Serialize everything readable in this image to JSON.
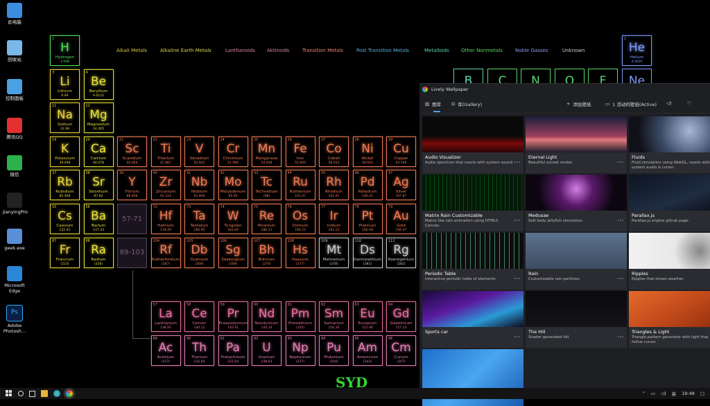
{
  "desktop_icons": [
    {
      "label": "此电脑",
      "icon": "computer-icon"
    },
    {
      "label": "回收站",
      "icon": "recycle-bin-icon"
    },
    {
      "label": "控制面板",
      "icon": "control-panel-icon"
    },
    {
      "label": "腾讯QQ",
      "icon": "qq-icon"
    },
    {
      "label": "微信",
      "icon": "wechat-icon"
    },
    {
      "label": "JianyingPro",
      "icon": "jianying-icon"
    },
    {
      "label": "geek.exe",
      "icon": "geek-icon"
    },
    {
      "label": "Microsoft Edge",
      "icon": "edge-icon"
    },
    {
      "label": "Adobe Photosh...",
      "icon": "photoshop-icon"
    }
  ],
  "legend": [
    {
      "label": "Alkali Metals",
      "color": "#d7c347"
    },
    {
      "label": "Alkaline Earth Metals",
      "color": "#d7d64a"
    },
    {
      "label": "Lanthanoids",
      "color": "#d98aa9"
    },
    {
      "label": "Aktinoids",
      "color": "#d48cae"
    },
    {
      "label": "Transition Metals",
      "color": "#e98a6d"
    },
    {
      "label": "Post Transition Metals",
      "color": "#5bb0de"
    },
    {
      "label": "Metalloids",
      "color": "#5ed4b4"
    },
    {
      "label": "Other Nonmetals",
      "color": "#5bd96b"
    },
    {
      "label": "Noble Gasses",
      "color": "#8ea0ef"
    },
    {
      "label": "Unknown",
      "color": "#cccccc"
    }
  ],
  "elements": [
    {
      "n": "1",
      "s": "H",
      "name": "Hydrogen",
      "m": "1.008",
      "c": "#4fe25b",
      "col": 0,
      "row": 0
    },
    {
      "n": "2",
      "s": "He",
      "name": "Helium",
      "m": "4.0026",
      "c": "#7e9cff",
      "col": 17,
      "row": 0
    },
    {
      "n": "3",
      "s": "Li",
      "name": "Lithium",
      "m": "6.94",
      "c": "#e9d43c",
      "col": 0,
      "row": 1
    },
    {
      "n": "4",
      "s": "Be",
      "name": "Beryllium",
      "m": "9.0122",
      "c": "#e6e23d",
      "col": 1,
      "row": 1
    },
    {
      "n": "11",
      "s": "Na",
      "name": "Sodium",
      "m": "22.99",
      "c": "#e9d43c",
      "col": 0,
      "row": 2
    },
    {
      "n": "12",
      "s": "Mg",
      "name": "Magnesium",
      "m": "24.305",
      "c": "#e6e23d",
      "col": 1,
      "row": 2
    },
    {
      "n": "19",
      "s": "K",
      "name": "Potassium",
      "m": "39.098",
      "c": "#e9d43c",
      "col": 0,
      "row": 3
    },
    {
      "n": "20",
      "s": "Ca",
      "name": "Calcium",
      "m": "40.078",
      "c": "#e6e23d",
      "col": 1,
      "row": 3
    },
    {
      "n": "21",
      "s": "Sc",
      "name": "Scandium",
      "m": "44.956",
      "c": "#f07a55",
      "col": 2,
      "row": 3
    },
    {
      "n": "22",
      "s": "Ti",
      "name": "Titanium",
      "m": "47.867",
      "c": "#f07a55",
      "col": 3,
      "row": 3
    },
    {
      "n": "23",
      "s": "V",
      "name": "Vanadium",
      "m": "50.942",
      "c": "#f07a55",
      "col": 4,
      "row": 3
    },
    {
      "n": "24",
      "s": "Cr",
      "name": "Chromium",
      "m": "51.996",
      "c": "#f07a55",
      "col": 5,
      "row": 3
    },
    {
      "n": "25",
      "s": "Mn",
      "name": "Manganese",
      "m": "54.938",
      "c": "#f07a55",
      "col": 6,
      "row": 3
    },
    {
      "n": "26",
      "s": "Fe",
      "name": "Iron",
      "m": "55.845",
      "c": "#f07a55",
      "col": 7,
      "row": 3
    },
    {
      "n": "27",
      "s": "Co",
      "name": "Cobalt",
      "m": "58.933",
      "c": "#f07a55",
      "col": 8,
      "row": 3
    },
    {
      "n": "28",
      "s": "Ni",
      "name": "Nickel",
      "m": "58.693",
      "c": "#f07a55",
      "col": 9,
      "row": 3
    },
    {
      "n": "29",
      "s": "Cu",
      "name": "Copper",
      "m": "63.546",
      "c": "#f07a55",
      "col": 10,
      "row": 3
    },
    {
      "n": "37",
      "s": "Rb",
      "name": "Rubidium",
      "m": "85.468",
      "c": "#e9d43c",
      "col": 0,
      "row": 4
    },
    {
      "n": "38",
      "s": "Sr",
      "name": "Strontium",
      "m": "87.62",
      "c": "#e6e23d",
      "col": 1,
      "row": 4
    },
    {
      "n": "39",
      "s": "Y",
      "name": "Yttrium",
      "m": "88.906",
      "c": "#f07a55",
      "col": 2,
      "row": 4
    },
    {
      "n": "40",
      "s": "Zr",
      "name": "Zirconium",
      "m": "91.224",
      "c": "#f07a55",
      "col": 3,
      "row": 4
    },
    {
      "n": "41",
      "s": "Nb",
      "name": "Niobium",
      "m": "92.906",
      "c": "#f07a55",
      "col": 4,
      "row": 4
    },
    {
      "n": "42",
      "s": "Mo",
      "name": "Molybdenum",
      "m": "95.95",
      "c": "#f07a55",
      "col": 5,
      "row": 4
    },
    {
      "n": "43",
      "s": "Tc",
      "name": "Technetium",
      "m": "(98)",
      "c": "#f07a55",
      "col": 6,
      "row": 4
    },
    {
      "n": "44",
      "s": "Ru",
      "name": "Ruthenium",
      "m": "101.07",
      "c": "#f07a55",
      "col": 7,
      "row": 4
    },
    {
      "n": "45",
      "s": "Rh",
      "name": "Rhodium",
      "m": "102.91",
      "c": "#f07a55",
      "col": 8,
      "row": 4
    },
    {
      "n": "46",
      "s": "Pd",
      "name": "Palladium",
      "m": "106.42",
      "c": "#f07a55",
      "col": 9,
      "row": 4
    },
    {
      "n": "47",
      "s": "Ag",
      "name": "Silver",
      "m": "107.87",
      "c": "#f07a55",
      "col": 10,
      "row": 4
    },
    {
      "n": "55",
      "s": "Cs",
      "name": "Caesium",
      "m": "132.91",
      "c": "#e9d43c",
      "col": 0,
      "row": 5
    },
    {
      "n": "56",
      "s": "Ba",
      "name": "Barium",
      "m": "137.33",
      "c": "#e6e23d",
      "col": 1,
      "row": 5
    },
    {
      "n": "72",
      "s": "Hf",
      "name": "Hafnium",
      "m": "178.49",
      "c": "#f07a55",
      "col": 3,
      "row": 5
    },
    {
      "n": "73",
      "s": "Ta",
      "name": "Tantalum",
      "m": "180.95",
      "c": "#f07a55",
      "col": 4,
      "row": 5
    },
    {
      "n": "74",
      "s": "W",
      "name": "Tungsten",
      "m": "183.84",
      "c": "#f07a55",
      "col": 5,
      "row": 5
    },
    {
      "n": "75",
      "s": "Re",
      "name": "Rhenium",
      "m": "186.21",
      "c": "#f07a55",
      "col": 6,
      "row": 5
    },
    {
      "n": "76",
      "s": "Os",
      "name": "Osmium",
      "m": "190.23",
      "c": "#f07a55",
      "col": 7,
      "row": 5
    },
    {
      "n": "77",
      "s": "Ir",
      "name": "Iridium",
      "m": "192.22",
      "c": "#f07a55",
      "col": 8,
      "row": 5
    },
    {
      "n": "78",
      "s": "Pt",
      "name": "Platinum",
      "m": "195.08",
      "c": "#f07a55",
      "col": 9,
      "row": 5
    },
    {
      "n": "79",
      "s": "Au",
      "name": "Gold",
      "m": "196.97",
      "c": "#f07a55",
      "col": 10,
      "row": 5
    },
    {
      "n": "87",
      "s": "Fr",
      "name": "Francium",
      "m": "(223)",
      "c": "#e9d43c",
      "col": 0,
      "row": 6
    },
    {
      "n": "88",
      "s": "Ra",
      "name": "Radium",
      "m": "(226)",
      "c": "#e6e23d",
      "col": 1,
      "row": 6
    },
    {
      "n": "104",
      "s": "Rf",
      "name": "Rutherfordium",
      "m": "(267)",
      "c": "#f07a55",
      "col": 3,
      "row": 6
    },
    {
      "n": "105",
      "s": "Db",
      "name": "Dubnium",
      "m": "(268)",
      "c": "#f07a55",
      "col": 4,
      "row": 6
    },
    {
      "n": "106",
      "s": "Sg",
      "name": "Seaborgium",
      "m": "(269)",
      "c": "#f07a55",
      "col": 5,
      "row": 6
    },
    {
      "n": "107",
      "s": "Bh",
      "name": "Bohrium",
      "m": "(270)",
      "c": "#f07a55",
      "col": 6,
      "row": 6
    },
    {
      "n": "108",
      "s": "Hs",
      "name": "Hassium",
      "m": "(277)",
      "c": "#f07a55",
      "col": 7,
      "row": 6
    },
    {
      "n": "109",
      "s": "Mt",
      "name": "Meitnerium",
      "m": "(278)",
      "c": "#c9c9c9",
      "col": 8,
      "row": 6
    },
    {
      "n": "110",
      "s": "Ds",
      "name": "Darmstadtium",
      "m": "(281)",
      "c": "#c9c9c9",
      "col": 9,
      "row": 6
    },
    {
      "n": "111",
      "s": "Rg",
      "name": "Roentgenium",
      "m": "(282)",
      "c": "#c9c9c9",
      "col": 10,
      "row": 6
    },
    {
      "n": "57",
      "s": "La",
      "name": "Lanthanum",
      "m": "138.91",
      "c": "#ea6fa0",
      "col": 3,
      "row": 7.9
    },
    {
      "n": "58",
      "s": "Ce",
      "name": "Cerium",
      "m": "140.12",
      "c": "#ea6fa0",
      "col": 4,
      "row": 7.9
    },
    {
      "n": "59",
      "s": "Pr",
      "name": "Praseodymium",
      "m": "140.91",
      "c": "#ea6fa0",
      "col": 5,
      "row": 7.9
    },
    {
      "n": "60",
      "s": "Nd",
      "name": "Neodymium",
      "m": "144.24",
      "c": "#ea6fa0",
      "col": 6,
      "row": 7.9
    },
    {
      "n": "61",
      "s": "Pm",
      "name": "Promethium",
      "m": "(145)",
      "c": "#ea6fa0",
      "col": 7,
      "row": 7.9
    },
    {
      "n": "62",
      "s": "Sm",
      "name": "Samarium",
      "m": "150.36",
      "c": "#ea6fa0",
      "col": 8,
      "row": 7.9
    },
    {
      "n": "63",
      "s": "Eu",
      "name": "Europium",
      "m": "151.96",
      "c": "#ea6fa0",
      "col": 9,
      "row": 7.9
    },
    {
      "n": "64",
      "s": "Gd",
      "name": "Gadolinium",
      "m": "157.25",
      "c": "#ea6fa0",
      "col": 10,
      "row": 7.9
    },
    {
      "n": "89",
      "s": "Ac",
      "name": "Actinium",
      "m": "(227)",
      "c": "#e57fb6",
      "col": 3,
      "row": 8.9
    },
    {
      "n": "90",
      "s": "Th",
      "name": "Thorium",
      "m": "232.04",
      "c": "#e57fb6",
      "col": 4,
      "row": 8.9
    },
    {
      "n": "91",
      "s": "Pa",
      "name": "Protactinium",
      "m": "231.04",
      "c": "#e57fb6",
      "col": 5,
      "row": 8.9
    },
    {
      "n": "92",
      "s": "U",
      "name": "Uranium",
      "m": "238.03",
      "c": "#e57fb6",
      "col": 6,
      "row": 8.9
    },
    {
      "n": "93",
      "s": "Np",
      "name": "Neptunium",
      "m": "(237)",
      "c": "#e57fb6",
      "col": 7,
      "row": 8.9
    },
    {
      "n": "94",
      "s": "Pu",
      "name": "Plutonium",
      "m": "(244)",
      "c": "#e57fb6",
      "col": 8,
      "row": 8.9
    },
    {
      "n": "95",
      "s": "Am",
      "name": "Americium",
      "m": "(243)",
      "c": "#e57fb6",
      "col": 9,
      "row": 8.9
    },
    {
      "n": "96",
      "s": "Cm",
      "name": "Curium",
      "m": "(247)",
      "c": "#e57fb6",
      "col": 10,
      "row": 8.9
    }
  ],
  "partial_elements": [
    {
      "s": "B",
      "c": "#5ed4b4"
    },
    {
      "s": "C",
      "c": "#5bd96b"
    },
    {
      "s": "N",
      "c": "#5bd96b"
    },
    {
      "s": "O",
      "c": "#5bd96b"
    },
    {
      "s": "F",
      "c": "#5bd96b"
    },
    {
      "s": "Ne",
      "c": "#7e9cff"
    }
  ],
  "placeholders": [
    "57-71",
    "89-103"
  ],
  "lively": {
    "title": "Lively Wallpaper",
    "tab_library": "图库",
    "tab_gallery": "库(Gallery)",
    "add_wallpaper": "添加壁纸",
    "active_wallpapers": "1 活动的壁纸(Active)",
    "cards": [
      {
        "title": "Audio Visualizer",
        "desc": "Audio spectrum that reacts with system sound.",
        "theme": "audio"
      },
      {
        "title": "Eternal Light",
        "desc": "Beautiful sunset render.",
        "theme": "sunset"
      },
      {
        "title": "Fluids",
        "desc": "Fluid simulation using WebGL, reacts with system audio & cursor.",
        "theme": "fluids"
      },
      {
        "title": "Matrix Rain Customizable",
        "desc": "Matrix like rain animation using HTML5 Canvas.",
        "theme": "matrix"
      },
      {
        "title": "Medusae",
        "desc": "Soft body jellyfish simulation.",
        "theme": "jelly"
      },
      {
        "title": "Parallax.js",
        "desc": "Parallax.js engine github page.",
        "theme": "parallax"
      },
      {
        "title": "Periodic Table",
        "desc": "Interactive periodic table of elements.",
        "theme": "periodic"
      },
      {
        "title": "Rain",
        "desc": "Customizable rain particles.",
        "theme": "rain"
      },
      {
        "title": "Ripples",
        "desc": "Ripples that shows weather.",
        "theme": "ripples"
      },
      {
        "title": "Sports car",
        "desc": "",
        "theme": "car"
      },
      {
        "title": "The Hill",
        "desc": "Shader generated hill.",
        "theme": "hill"
      },
      {
        "title": "Triangles & Light",
        "desc": "Triangle pattern generator with light that follow cursor.",
        "theme": "triangles"
      },
      {
        "title": "",
        "desc": "",
        "theme": "blue"
      }
    ]
  },
  "watermark": "SYD",
  "taskbar": {
    "time": "19:48",
    "ime": "英"
  }
}
